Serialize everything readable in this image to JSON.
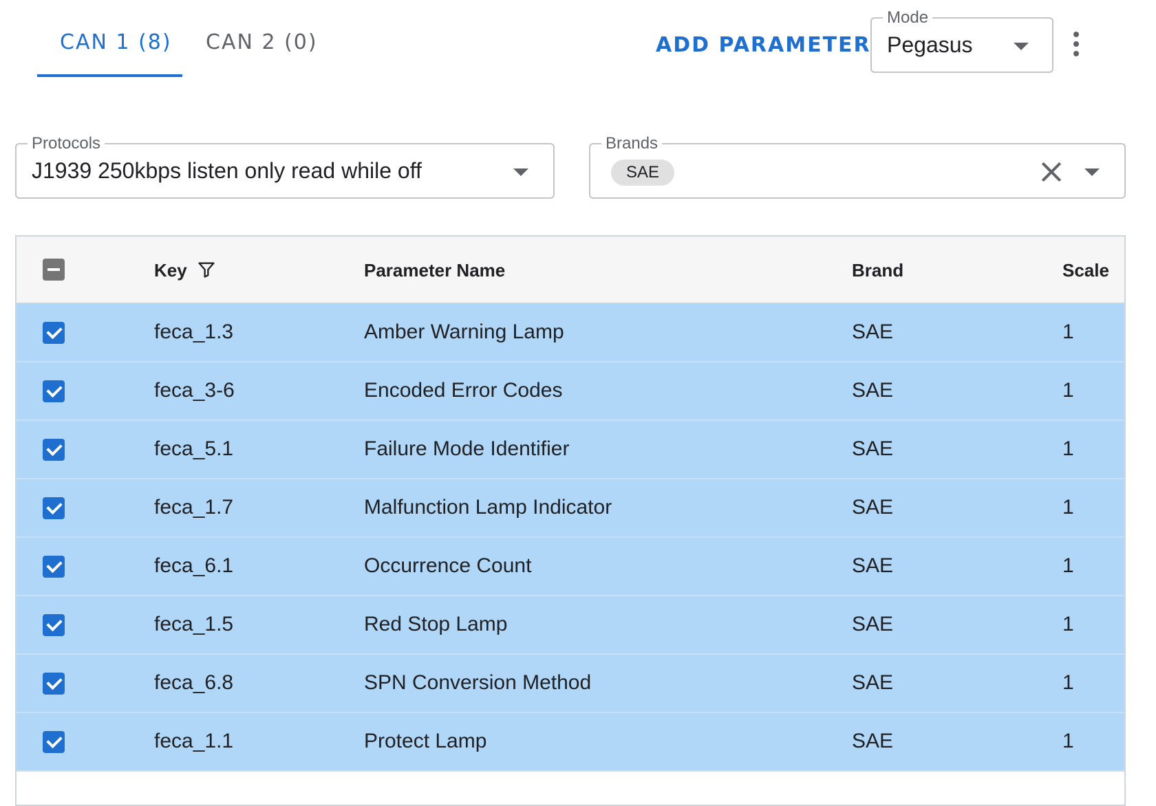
{
  "tabs": [
    {
      "label": "CAN 1 (8)",
      "active": true
    },
    {
      "label": "CAN 2 (0)",
      "active": false
    }
  ],
  "toolbar": {
    "add_parameter_label": "ADD PARAMETER",
    "mode_legend": "Mode",
    "mode_value": "Pegasus",
    "more_icon": "kebab-menu-icon"
  },
  "filters": {
    "protocols_legend": "Protocols",
    "protocols_value": "J1939 250kbps listen only read while off",
    "brands_legend": "Brands",
    "brands_chip": "SAE"
  },
  "table": {
    "columns": {
      "key": "Key",
      "parameter_name": "Parameter Name",
      "brand": "Brand",
      "scale": "Scale"
    },
    "rows": [
      {
        "key": "feca_1.3",
        "name": "Amber Warning Lamp",
        "brand": "SAE",
        "scale": "1"
      },
      {
        "key": "feca_3-6",
        "name": "Encoded Error Codes",
        "brand": "SAE",
        "scale": "1"
      },
      {
        "key": "feca_5.1",
        "name": "Failure Mode Identifier",
        "brand": "SAE",
        "scale": "1"
      },
      {
        "key": "feca_1.7",
        "name": "Malfunction Lamp Indicator",
        "brand": "SAE",
        "scale": "1"
      },
      {
        "key": "feca_6.1",
        "name": "Occurrence Count",
        "brand": "SAE",
        "scale": "1"
      },
      {
        "key": "feca_1.5",
        "name": "Red Stop Lamp",
        "brand": "SAE",
        "scale": "1"
      },
      {
        "key": "feca_6.8",
        "name": "SPN Conversion Method",
        "brand": "SAE",
        "scale": "1"
      },
      {
        "key": "feca_1.1",
        "name": "Protect Lamp",
        "brand": "SAE",
        "scale": "1"
      }
    ]
  },
  "colors": {
    "accent": "#1e6fd0",
    "row_selected": "#b0d6f8",
    "header_bg": "#f6f6f6"
  }
}
